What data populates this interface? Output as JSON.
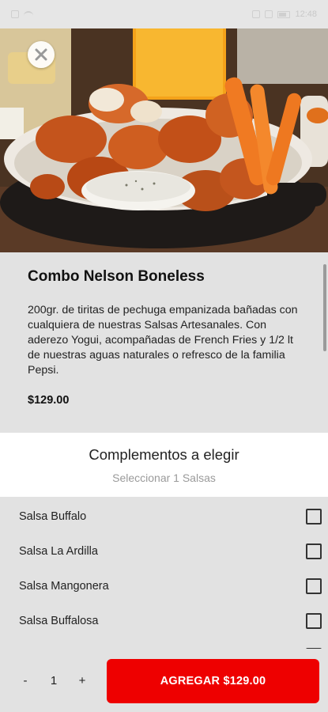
{
  "status_bar": {
    "time": "12:48"
  },
  "product": {
    "name": "Combo Nelson Boneless",
    "description": "200gr. de tiritas de pechuga empanizada bañadas con cualquiera de nuestras Salsas Artesanales. Con aderezo Yogui, acompañadas de French Fries y 1/2 lt de nuestras aguas naturales o refresco de la familia Pepsi.",
    "price": "$129.00"
  },
  "complements": {
    "title": "Complementos a elegir",
    "subtitle": "Seleccionar 1 Salsas",
    "options": [
      {
        "label": "Salsa Buffalo",
        "checked": false
      },
      {
        "label": "Salsa La Ardilla",
        "checked": false
      },
      {
        "label": "Salsa Mangonera",
        "checked": false
      },
      {
        "label": "Salsa Buffalosa",
        "checked": false
      }
    ]
  },
  "cart": {
    "minus": "-",
    "quantity": "1",
    "plus": "+",
    "add_label": "AGREGAR $129.00"
  },
  "colors": {
    "accent": "#ee0000",
    "background": "#e2e2e2"
  }
}
